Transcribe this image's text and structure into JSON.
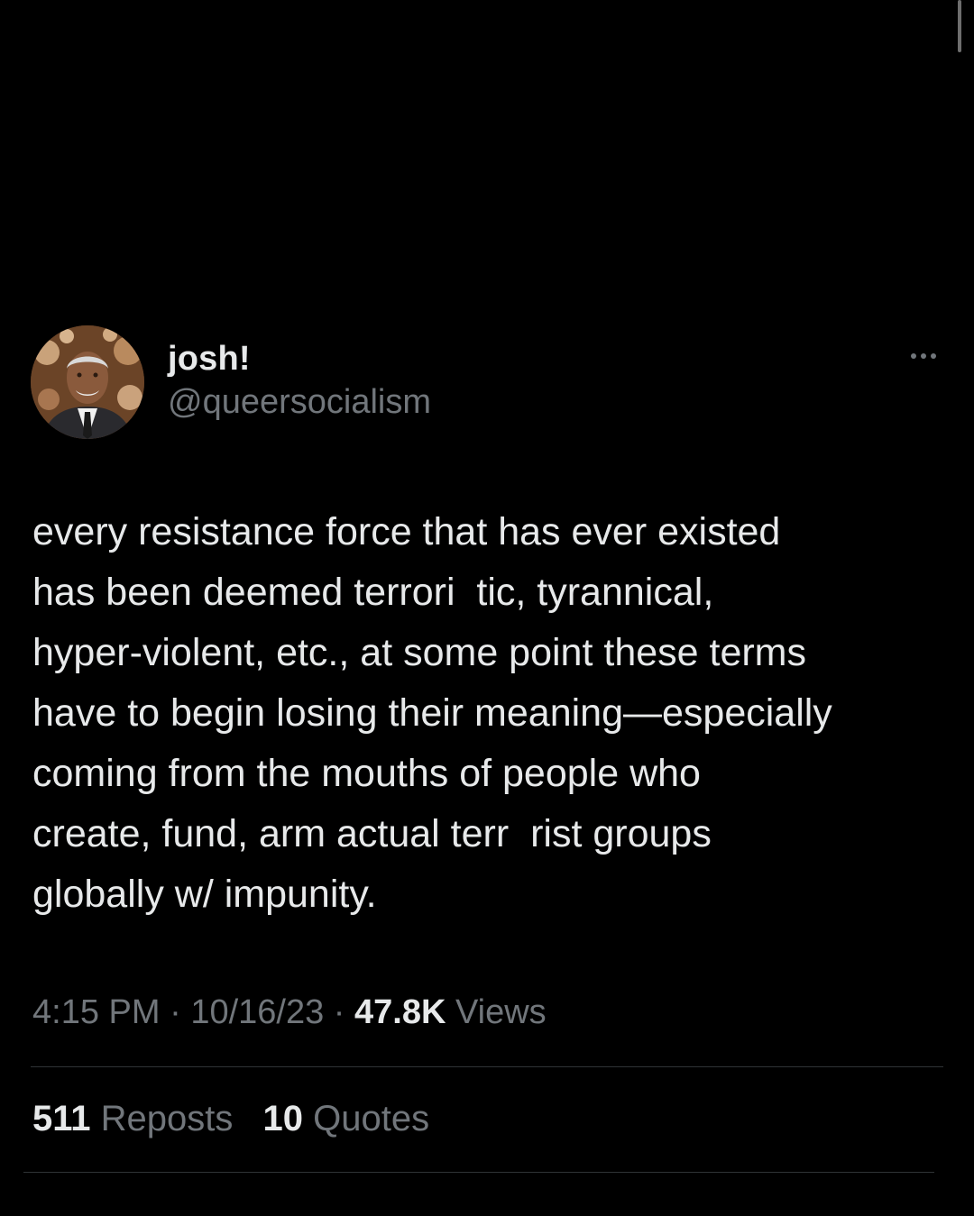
{
  "author": {
    "display_name": "josh!",
    "handle": "@queersocialism",
    "avatar_icon": "user-avatar"
  },
  "tweet": {
    "lines": [
      "every resistance force that has ever existed",
      "has been deemed terrori  tic, tyrannical,",
      "hyper-violent, etc., at some point these terms",
      "have to begin losing their meaning—especially",
      "coming from the mouths of people who",
      "create, fund, arm actual terr  rist groups",
      "globally w/ impunity."
    ]
  },
  "meta": {
    "time": "4:15 PM",
    "sep1": " · ",
    "date": "10/16/23",
    "sep2": " · ",
    "views_count": "47.8K",
    "views_label": " Views"
  },
  "stats": {
    "reposts_count": "511",
    "reposts_label": "Reposts",
    "quotes_count": "10",
    "quotes_label": "Quotes"
  },
  "icons": {
    "more": "more-options-icon"
  },
  "colors": {
    "background": "#000000",
    "primary_text": "#e7e9ea",
    "secondary_text": "#71767b",
    "divider": "#2f3336"
  }
}
